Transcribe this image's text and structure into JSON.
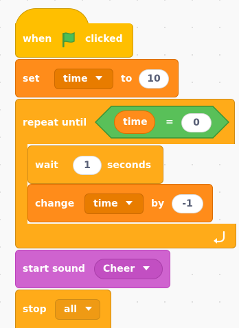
{
  "script": {
    "hat": {
      "when_label": "when",
      "flag_icon": "green-flag-icon",
      "clicked_label": "clicked"
    },
    "set_block": {
      "label": "set",
      "variable": "time",
      "to_label": "to",
      "value": "10"
    },
    "repeat_until": {
      "label": "repeat until",
      "condition": {
        "left": "time",
        "operator": "=",
        "right": "0"
      },
      "loop_icon": "loop-arrow-icon"
    },
    "wait_block": {
      "label": "wait",
      "value": "1",
      "unit": "seconds"
    },
    "change_block": {
      "label": "change",
      "variable": "time",
      "by_label": "by",
      "value": "-1"
    },
    "sound_block": {
      "label": "start sound",
      "sound": "Cheer"
    },
    "stop_block": {
      "label": "stop",
      "option": "all"
    }
  },
  "colors": {
    "events": "#ffbf00",
    "variables": "#ff8c1a",
    "control": "#ffab19",
    "sound": "#cf63cf",
    "operators": "#59c059",
    "canvas": "#f9f9f9"
  }
}
